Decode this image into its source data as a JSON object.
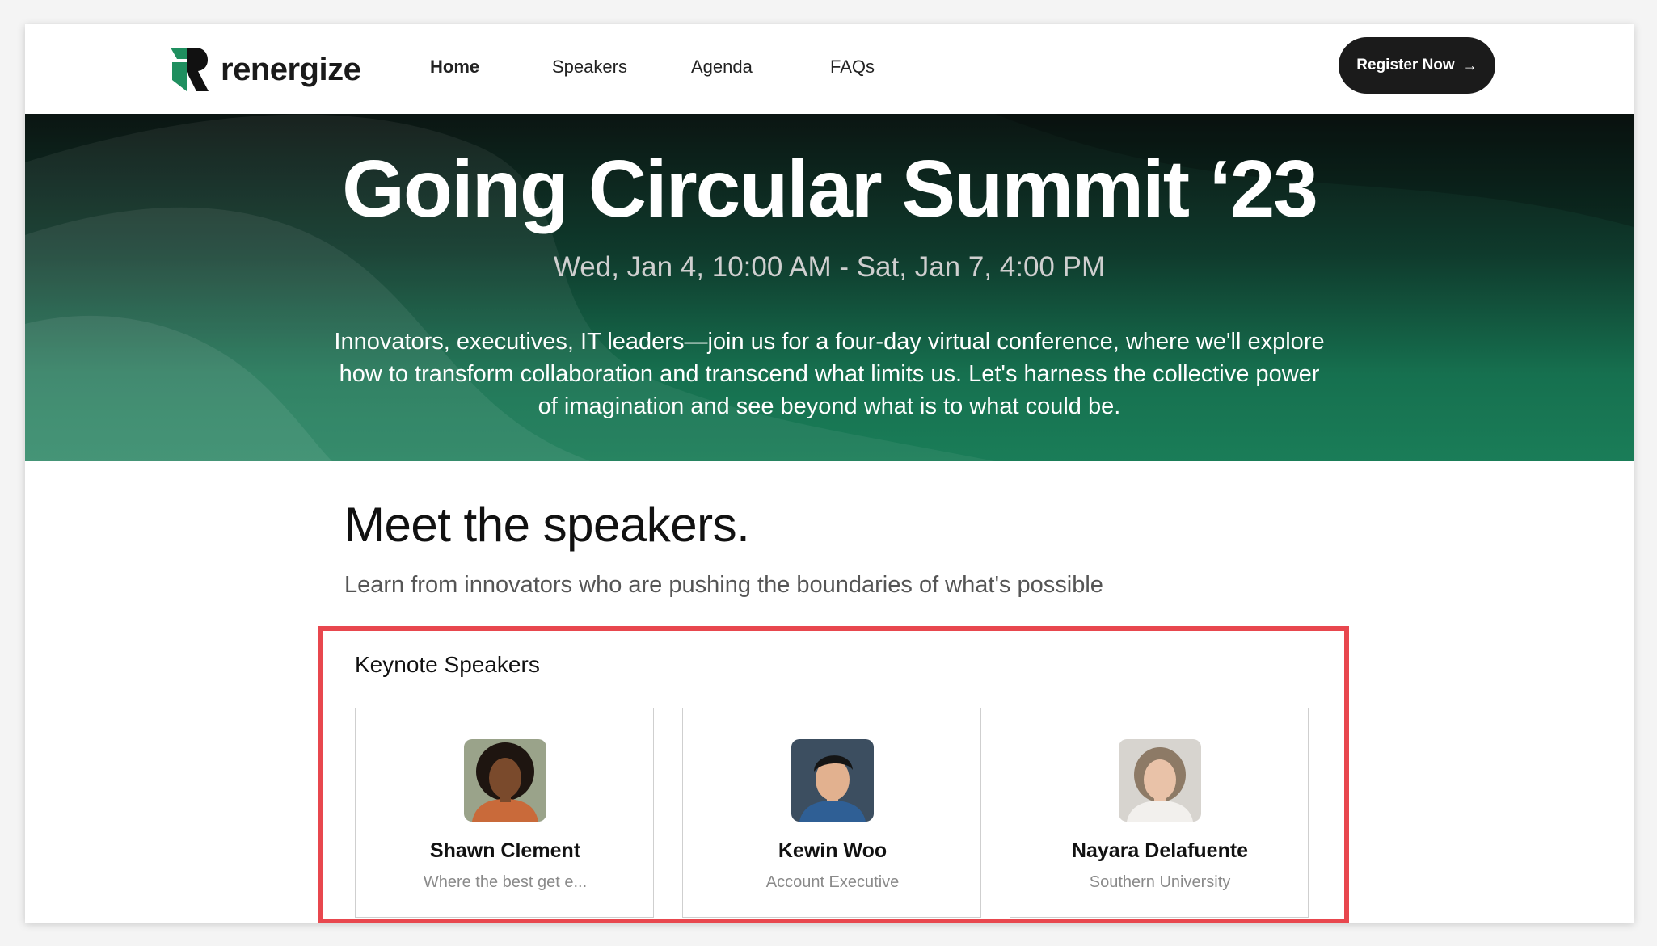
{
  "brand": {
    "name": "renergize",
    "logo_colors": [
      "#1f8f5f",
      "#111111"
    ]
  },
  "nav": {
    "items": [
      {
        "label": "Home",
        "active": true
      },
      {
        "label": "Speakers",
        "active": false
      },
      {
        "label": "Agenda",
        "active": false
      },
      {
        "label": "FAQs",
        "active": false
      }
    ],
    "register_label": "Register Now",
    "register_icon": "arrow-right-icon"
  },
  "hero": {
    "title": "Going Circular Summit ‘23",
    "date": "Wed, Jan 4, 10:00 AM - Sat, Jan 7, 4:00 PM",
    "description": "Innovators, executives, IT leaders—join us for a four-day virtual conference, where we'll explore how to transform collaboration and transcend what limits us. Let's harness the collective power of imagination and see beyond what is to what could be.",
    "gradient": [
      "#0b1512",
      "#1a7d58"
    ]
  },
  "speakers_section": {
    "title": "Meet the speakers.",
    "subtitle": "Learn from innovators who are pushing the boundaries of what's possible",
    "keynote": {
      "title": "Keynote Speakers",
      "highlight_color": "#e8474e",
      "speakers": [
        {
          "name": "Shawn Clement",
          "role": "Where the best get e...",
          "avatar_icon": "speaker-photo"
        },
        {
          "name": "Kewin Woo",
          "role": "Account Executive",
          "avatar_icon": "speaker-photo"
        },
        {
          "name": "Nayara Delafuente",
          "role": "Southern University",
          "avatar_icon": "speaker-photo"
        }
      ]
    }
  }
}
